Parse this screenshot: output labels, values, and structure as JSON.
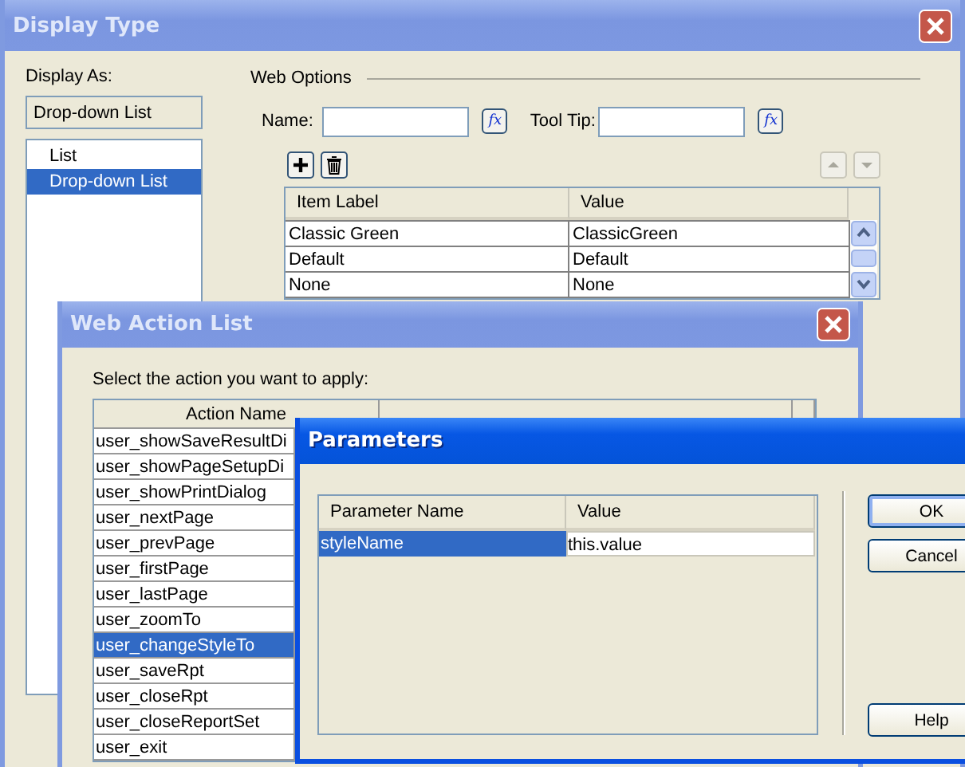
{
  "display_type": {
    "title": "Display Type",
    "display_as": {
      "label": "Display As:",
      "value": "Drop-down List",
      "options": [
        {
          "label": "List",
          "selected": false
        },
        {
          "label": "Drop-down List",
          "selected": true
        }
      ]
    },
    "web_options": {
      "heading": "Web Options",
      "name_label": "Name:",
      "tooltip_label": "Tool Tip:",
      "name_function_button": "fx",
      "tooltip_function_button": "fx",
      "table": {
        "columns": [
          "Item Label",
          "Value"
        ],
        "rows": [
          [
            "Classic Green",
            "ClassicGreen"
          ],
          [
            "Default",
            "Default"
          ],
          [
            "None",
            "None"
          ]
        ]
      }
    }
  },
  "web_action_list": {
    "title": "Web Action List",
    "prompt": "Select the action you want to apply:",
    "table": {
      "columns": [
        "Action Name"
      ],
      "rows": [
        {
          "name": "user_showSaveResultDi",
          "selected": false
        },
        {
          "name": "user_showPageSetupDi",
          "selected": false
        },
        {
          "name": "user_showPrintDialog",
          "selected": false
        },
        {
          "name": "user_nextPage",
          "selected": false
        },
        {
          "name": "user_prevPage",
          "selected": false
        },
        {
          "name": "user_firstPage",
          "selected": false
        },
        {
          "name": "user_lastPage",
          "selected": false
        },
        {
          "name": "user_zoomTo",
          "selected": false
        },
        {
          "name": "user_changeStyleTo",
          "selected": true
        },
        {
          "name": "user_saveRpt",
          "selected": false
        },
        {
          "name": "user_closeRpt",
          "selected": false
        },
        {
          "name": "user_closeReportSet",
          "selected": false
        },
        {
          "name": "user_exit",
          "selected": false
        }
      ]
    }
  },
  "parameters": {
    "title": "Parameters",
    "table": {
      "columns": [
        "Parameter Name",
        "Value"
      ],
      "rows": [
        {
          "name": "styleName",
          "value": "this.value",
          "selected": true
        }
      ]
    },
    "buttons": [
      {
        "label": "OK",
        "default": true
      },
      {
        "label": "Cancel",
        "default": false
      },
      {
        "label": "Help",
        "default": false
      }
    ]
  }
}
